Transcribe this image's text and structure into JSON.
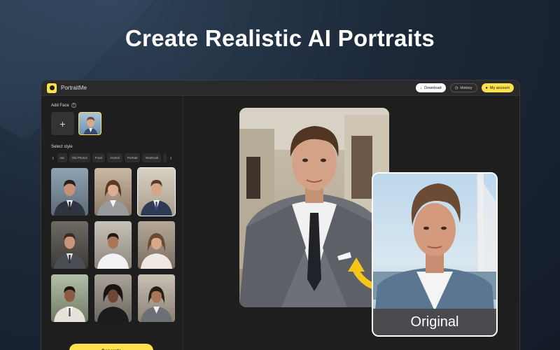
{
  "headline": "Create Realistic AI Portraits",
  "app": {
    "name": "PortraitMe"
  },
  "toolbar": {
    "download_label": "Download",
    "history_label": "History",
    "account_label": "My account"
  },
  "sidebar": {
    "add_face_label": "Add Face",
    "add_face_button": "+",
    "select_style_label": "Select style",
    "style_tabs": [
      "nal",
      "Old Photos",
      "Food",
      "Animal",
      "Portrait",
      "Yearbook"
    ],
    "generate_label": "Generate"
  },
  "main": {
    "original_label": "Original"
  },
  "colors": {
    "accent": "#ffe14d",
    "window_bg": "#1e1e1f"
  }
}
